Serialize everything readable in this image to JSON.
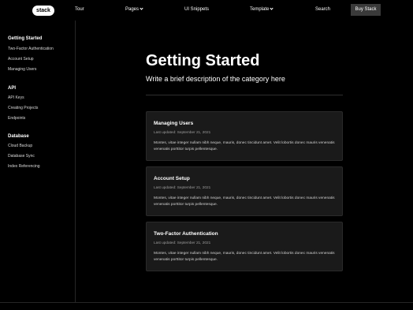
{
  "header": {
    "logo": "stack",
    "nav": {
      "tour": "Tour",
      "pages": "Pages",
      "ui_snippets": "UI Snippets",
      "template": "Template",
      "search": "Search"
    },
    "buy_label": "Buy Stack"
  },
  "sidebar": {
    "sections": [
      {
        "title": "Getting Started",
        "items": [
          "Two-Factor Authentication",
          "Account Setup",
          "Managing Users"
        ]
      },
      {
        "title": "API",
        "items": [
          "API Keys",
          "Creating Projects",
          "Endpoints"
        ]
      },
      {
        "title": "Database",
        "items": [
          "Cloud Backup",
          "Database Sync",
          "Index Referencing"
        ]
      }
    ]
  },
  "main": {
    "title": "Getting Started",
    "subtitle": "Write a brief description of the category here",
    "cards": [
      {
        "title": "Managing Users",
        "date": "Last updated: September 21, 2021",
        "body": "Montes, vitae integer nullam nibh neque, mauris, donec tincidunt amet. Velit lobortis donec mauris venenatis venenatis porttitor turpis pellentesque."
      },
      {
        "title": "Account Setup",
        "date": "Last updated: September 21, 2021",
        "body": "Montes, vitae integer nullam nibh neque, mauris, donec tincidunt amet. Velit lobortis donec mauris venenatis venenatis porttitor turpis pellentesque."
      },
      {
        "title": "Two-Factor Authentication",
        "date": "Last updated: September 21, 2021",
        "body": "Montes, vitae integer nullam nibh neque, mauris, donec tincidunt amet. Velit lobortis donec mauris venenatis venenatis porttitor turpis pellentesque."
      }
    ]
  }
}
